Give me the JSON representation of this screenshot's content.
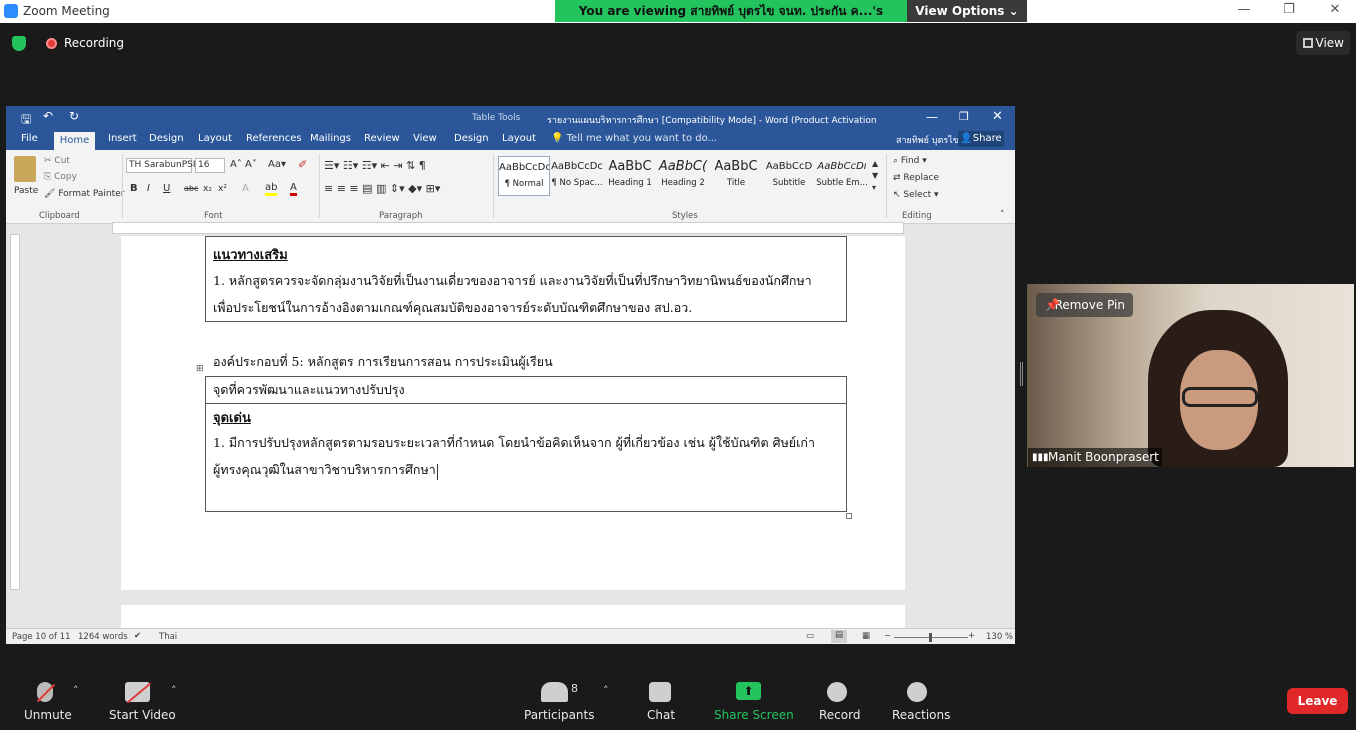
{
  "zoom": {
    "window_title": "Zoom Meeting",
    "viewing_banner": "You are viewing สายทิพย์ บุตรไข จนท. ประกัน ค...'s screen",
    "view_options": "View Options",
    "recording": "Recording",
    "view": "View",
    "remove_pin": "Remove Pin",
    "participant_name": "Manit Boonprasert",
    "toolbar": {
      "unmute": "Unmute",
      "start_video": "Start Video",
      "participants": "Participants",
      "participants_count": "8",
      "chat": "Chat",
      "share_screen": "Share Screen",
      "record": "Record",
      "reactions": "Reactions",
      "leave": "Leave"
    },
    "colors": {
      "accent_green": "#23c45e",
      "leave_red": "#e02828",
      "word_blue": "#2b579a"
    }
  },
  "word": {
    "title": "รายงานแผนบริหารการศึกษา [Compatibility Mode] - Word (Product Activation Failed)",
    "table_tools": "Table Tools",
    "user": "สายทิพย์ บุตรไข",
    "share": "Share",
    "tabs": [
      "File",
      "Home",
      "Insert",
      "Design",
      "Layout",
      "References",
      "Mailings",
      "Review",
      "View",
      "Design",
      "Layout"
    ],
    "tell_me": "Tell me what you want to do...",
    "clipboard": {
      "paste": "Paste",
      "cut": "Cut",
      "copy": "Copy",
      "format_painter": "Format Painter",
      "label": "Clipboard"
    },
    "font": {
      "name": "TH SarabunPSI",
      "size": "16",
      "label": "Font"
    },
    "paragraph_label": "Paragraph",
    "styles": [
      {
        "preview": "AaBbCcDc",
        "name": "¶ Normal"
      },
      {
        "preview": "AaBbCcDc",
        "name": "¶ No Spac..."
      },
      {
        "preview": "AaBbC",
        "name": "Heading 1"
      },
      {
        "preview": "AaBbC(",
        "name": "Heading 2"
      },
      {
        "preview": "AaBbC",
        "name": "Title"
      },
      {
        "preview": "AaBbCcD",
        "name": "Subtitle"
      },
      {
        "preview": "AaBbCcDı",
        "name": "Subtle Em..."
      }
    ],
    "styles_label": "Styles",
    "editing": {
      "find": "Find",
      "replace": "Replace",
      "select": "Select",
      "label": "Editing"
    },
    "doc": {
      "heading1": "แนวทางเสริม",
      "para1_line1": "1. หลักสูตรควรจะจัดกลุ่มงานวิจัยที่เป็นงานเดี่ยวของอาจารย์ และงานวิจัยที่เป็นที่ปรึกษาวิทยานิพนธ์ของนักศึกษา",
      "para1_line2": "เพื่อประโยชน์ในการอ้างอิงตามเกณฑ์คุณสมบัติของอาจารย์ระดับบัณฑิตศึกษาของ สป.อว.",
      "component": "องค์ประกอบที่ 5: หลักสูตร การเรียนการสอน การประเมินผู้เรียน",
      "table_header": "จุดที่ควรพัฒนาและแนวทางปรับปรุง",
      "heading2": "จุดเด่น",
      "para2_line1": "1. มีการปรับปรุงหลักสูตรตามรอบระยะเวลาที่กำหนด โดยนำข้อคิดเห็นจาก ผู้ที่เกี่ยวข้อง เช่น ผู้ใช้บัณฑิต ศิษย์เก่า",
      "para2_line2": "ผู้ทรงคุณวุฒิในสาขาวิชาบริหารการศึกษา"
    },
    "status": {
      "page": "Page 10 of 11",
      "words": "1264 words",
      "language": "Thai",
      "zoom": "130 %"
    }
  }
}
